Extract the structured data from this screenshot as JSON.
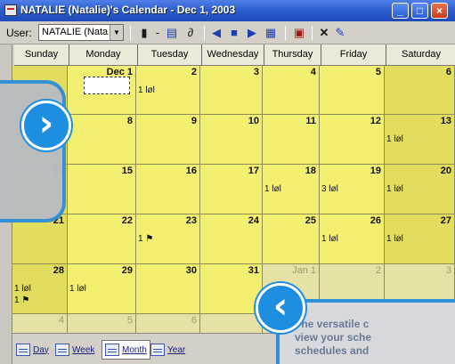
{
  "window": {
    "title": "NATALIE (Natalie)'s Calendar - Dec 1, 2003",
    "minimize": "_",
    "maximize": "□",
    "close": "×"
  },
  "toolbar": {
    "user_label": "User:",
    "user_value": "NATALIE (Nata",
    "icons": [
      "new-appointment-icon",
      "delete-icon",
      "address-book-icon",
      "find-icon",
      "previous-icon",
      "stop-icon",
      "next-icon",
      "go-to-date-icon",
      "print-icon",
      "delete-x-icon",
      "edit-icon"
    ]
  },
  "calendar": {
    "days_of_week": [
      "Sunday",
      "Monday",
      "Tuesday",
      "Wednesday",
      "Thursday",
      "Friday",
      "Saturday"
    ],
    "weeks": [
      [
        {
          "d": "",
          "m": 0
        },
        {
          "d": "Dec 1",
          "m": 0
        },
        {
          "d": "2",
          "m": 0,
          "appt": "1 løl"
        },
        {
          "d": "3",
          "m": 0
        },
        {
          "d": "4",
          "m": 0
        },
        {
          "d": "5",
          "m": 0
        },
        {
          "d": "6",
          "m": 0
        }
      ],
      [
        {
          "d": "",
          "m": 0
        },
        {
          "d": "8",
          "m": 0
        },
        {
          "d": "9",
          "m": 0
        },
        {
          "d": "10",
          "m": 0
        },
        {
          "d": "11",
          "m": 0
        },
        {
          "d": "12",
          "m": 0
        },
        {
          "d": "13",
          "m": 0,
          "appt": "1 løl"
        }
      ],
      [
        {
          "d": "14",
          "m": 0
        },
        {
          "d": "15",
          "m": 0
        },
        {
          "d": "16",
          "m": 0
        },
        {
          "d": "17",
          "m": 0
        },
        {
          "d": "18",
          "m": 0,
          "appt": "1 løl"
        },
        {
          "d": "19",
          "m": 0,
          "appt": "3 løl"
        },
        {
          "d": "20",
          "m": 0,
          "appt": "1 løl"
        }
      ],
      [
        {
          "d": "21",
          "m": 0
        },
        {
          "d": "22",
          "m": 0
        },
        {
          "d": "23",
          "m": 0,
          "appt": "1 ⚑"
        },
        {
          "d": "24",
          "m": 0
        },
        {
          "d": "25",
          "m": 0
        },
        {
          "d": "26",
          "m": 0,
          "appt": "1 løl"
        },
        {
          "d": "27",
          "m": 0,
          "appt": "1 løl"
        }
      ],
      [
        {
          "d": "28",
          "m": 0,
          "appt": "1 løl",
          "appt2": "1 ⚑"
        },
        {
          "d": "29",
          "m": 0,
          "appt": "1 løl"
        },
        {
          "d": "30",
          "m": 0
        },
        {
          "d": "31",
          "m": 0
        },
        {
          "d": "Jan 1",
          "m": 1
        },
        {
          "d": "2",
          "m": 1
        },
        {
          "d": "3",
          "m": 1
        }
      ],
      [
        {
          "d": "4",
          "m": 1
        },
        {
          "d": "5",
          "m": 1
        },
        {
          "d": "6",
          "m": 1
        },
        {
          "d": "",
          "m": 1
        },
        {
          "d": "",
          "m": 1
        },
        {
          "d": "",
          "m": 1
        },
        {
          "d": "",
          "m": 1
        }
      ]
    ]
  },
  "view_tabs": [
    {
      "label": "Day",
      "active": false
    },
    {
      "label": "Week",
      "active": false
    },
    {
      "label": "Month",
      "active": true
    },
    {
      "label": "Year",
      "active": false
    }
  ],
  "overlay": {
    "next_glyph": "›",
    "back_glyph": "‹",
    "promo_line1": "The versatile c",
    "promo_line2": "view your sche",
    "promo_line3": "schedules and"
  },
  "colors": {
    "cell": "#f3f071",
    "weekend": "#e3dd5f",
    "accent": "#1e8ee0",
    "title": "#2e5fd0"
  }
}
